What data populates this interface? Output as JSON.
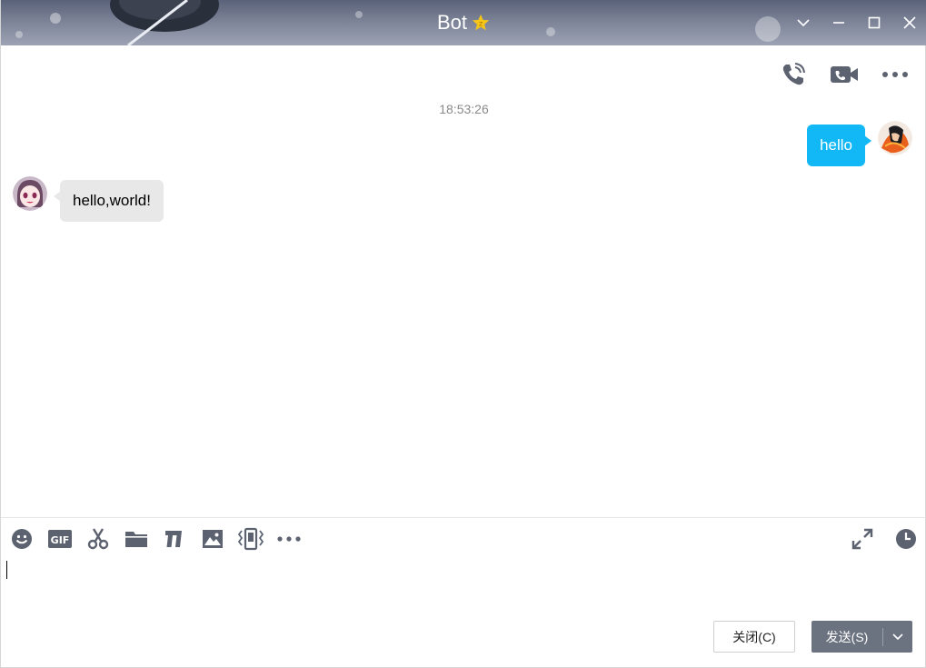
{
  "window": {
    "title": "Bot",
    "badge_icon": "star-badge-icon"
  },
  "chat": {
    "timestamp": "18:53:26",
    "messages": [
      {
        "direction": "out",
        "text": "hello"
      },
      {
        "direction": "in",
        "text": "hello,world!"
      }
    ]
  },
  "footer": {
    "close_label": "关闭(C)",
    "send_label": "发送(S)"
  },
  "colors": {
    "outgoing_bubble": "#12b7f5",
    "incoming_bubble": "#e8e8e8",
    "send_button": "#6b7280",
    "icon_gray": "#5c6270"
  }
}
